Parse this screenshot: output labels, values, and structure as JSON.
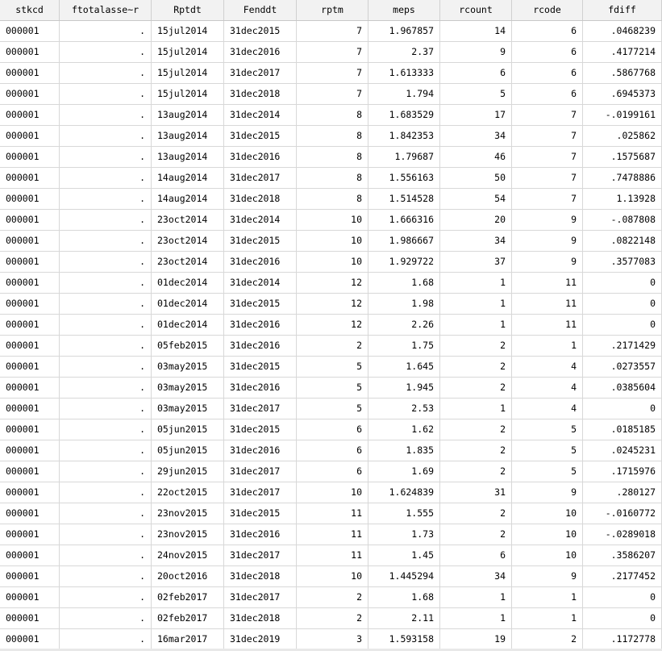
{
  "columns": [
    "stkcd",
    "ftotalasse~r",
    "Rptdt",
    "Fenddt",
    "rptm",
    "meps",
    "rcount",
    "rcode",
    "fdiff"
  ],
  "rows": [
    [
      "000001",
      ".",
      "15jul2014",
      "31dec2015",
      "7",
      "1.967857",
      "14",
      "6",
      ".0468239"
    ],
    [
      "000001",
      ".",
      "15jul2014",
      "31dec2016",
      "7",
      "2.37",
      "9",
      "6",
      ".4177214"
    ],
    [
      "000001",
      ".",
      "15jul2014",
      "31dec2017",
      "7",
      "1.613333",
      "6",
      "6",
      ".5867768"
    ],
    [
      "000001",
      ".",
      "15jul2014",
      "31dec2018",
      "7",
      "1.794",
      "5",
      "6",
      ".6945373"
    ],
    [
      "000001",
      ".",
      "13aug2014",
      "31dec2014",
      "8",
      "1.683529",
      "17",
      "7",
      "-.0199161"
    ],
    [
      "000001",
      ".",
      "13aug2014",
      "31dec2015",
      "8",
      "1.842353",
      "34",
      "7",
      ".025862"
    ],
    [
      "000001",
      ".",
      "13aug2014",
      "31dec2016",
      "8",
      "1.79687",
      "46",
      "7",
      ".1575687"
    ],
    [
      "000001",
      ".",
      "14aug2014",
      "31dec2017",
      "8",
      "1.556163",
      "50",
      "7",
      ".7478886"
    ],
    [
      "000001",
      ".",
      "14aug2014",
      "31dec2018",
      "8",
      "1.514528",
      "54",
      "7",
      "1.13928"
    ],
    [
      "000001",
      ".",
      "23oct2014",
      "31dec2014",
      "10",
      "1.666316",
      "20",
      "9",
      "-.087808"
    ],
    [
      "000001",
      ".",
      "23oct2014",
      "31dec2015",
      "10",
      "1.986667",
      "34",
      "9",
      ".0822148"
    ],
    [
      "000001",
      ".",
      "23oct2014",
      "31dec2016",
      "10",
      "1.929722",
      "37",
      "9",
      ".3577083"
    ],
    [
      "000001",
      ".",
      "01dec2014",
      "31dec2014",
      "12",
      "1.68",
      "1",
      "11",
      "0"
    ],
    [
      "000001",
      ".",
      "01dec2014",
      "31dec2015",
      "12",
      "1.98",
      "1",
      "11",
      "0"
    ],
    [
      "000001",
      ".",
      "01dec2014",
      "31dec2016",
      "12",
      "2.26",
      "1",
      "11",
      "0"
    ],
    [
      "000001",
      ".",
      "05feb2015",
      "31dec2016",
      "2",
      "1.75",
      "2",
      "1",
      ".2171429"
    ],
    [
      "000001",
      ".",
      "03may2015",
      "31dec2015",
      "5",
      "1.645",
      "2",
      "4",
      ".0273557"
    ],
    [
      "000001",
      ".",
      "03may2015",
      "31dec2016",
      "5",
      "1.945",
      "2",
      "4",
      ".0385604"
    ],
    [
      "000001",
      ".",
      "03may2015",
      "31dec2017",
      "5",
      "2.53",
      "1",
      "4",
      "0"
    ],
    [
      "000001",
      ".",
      "05jun2015",
      "31dec2015",
      "6",
      "1.62",
      "2",
      "5",
      ".0185185"
    ],
    [
      "000001",
      ".",
      "05jun2015",
      "31dec2016",
      "6",
      "1.835",
      "2",
      "5",
      ".0245231"
    ],
    [
      "000001",
      ".",
      "29jun2015",
      "31dec2017",
      "6",
      "1.69",
      "2",
      "5",
      ".1715976"
    ],
    [
      "000001",
      ".",
      "22oct2015",
      "31dec2017",
      "10",
      "1.624839",
      "31",
      "9",
      ".280127"
    ],
    [
      "000001",
      ".",
      "23nov2015",
      "31dec2015",
      "11",
      "1.555",
      "2",
      "10",
      "-.0160772"
    ],
    [
      "000001",
      ".",
      "23nov2015",
      "31dec2016",
      "11",
      "1.73",
      "2",
      "10",
      "-.0289018"
    ],
    [
      "000001",
      ".",
      "24nov2015",
      "31dec2017",
      "11",
      "1.45",
      "6",
      "10",
      ".3586207"
    ],
    [
      "000001",
      ".",
      "20oct2016",
      "31dec2018",
      "10",
      "1.445294",
      "34",
      "9",
      ".2177452"
    ],
    [
      "000001",
      ".",
      "02feb2017",
      "31dec2017",
      "2",
      "1.68",
      "1",
      "1",
      "0"
    ],
    [
      "000001",
      ".",
      "02feb2017",
      "31dec2018",
      "2",
      "2.11",
      "1",
      "1",
      "0"
    ],
    [
      "000001",
      ".",
      "16mar2017",
      "31dec2019",
      "3",
      "1.593158",
      "19",
      "2",
      ".1172778"
    ]
  ]
}
